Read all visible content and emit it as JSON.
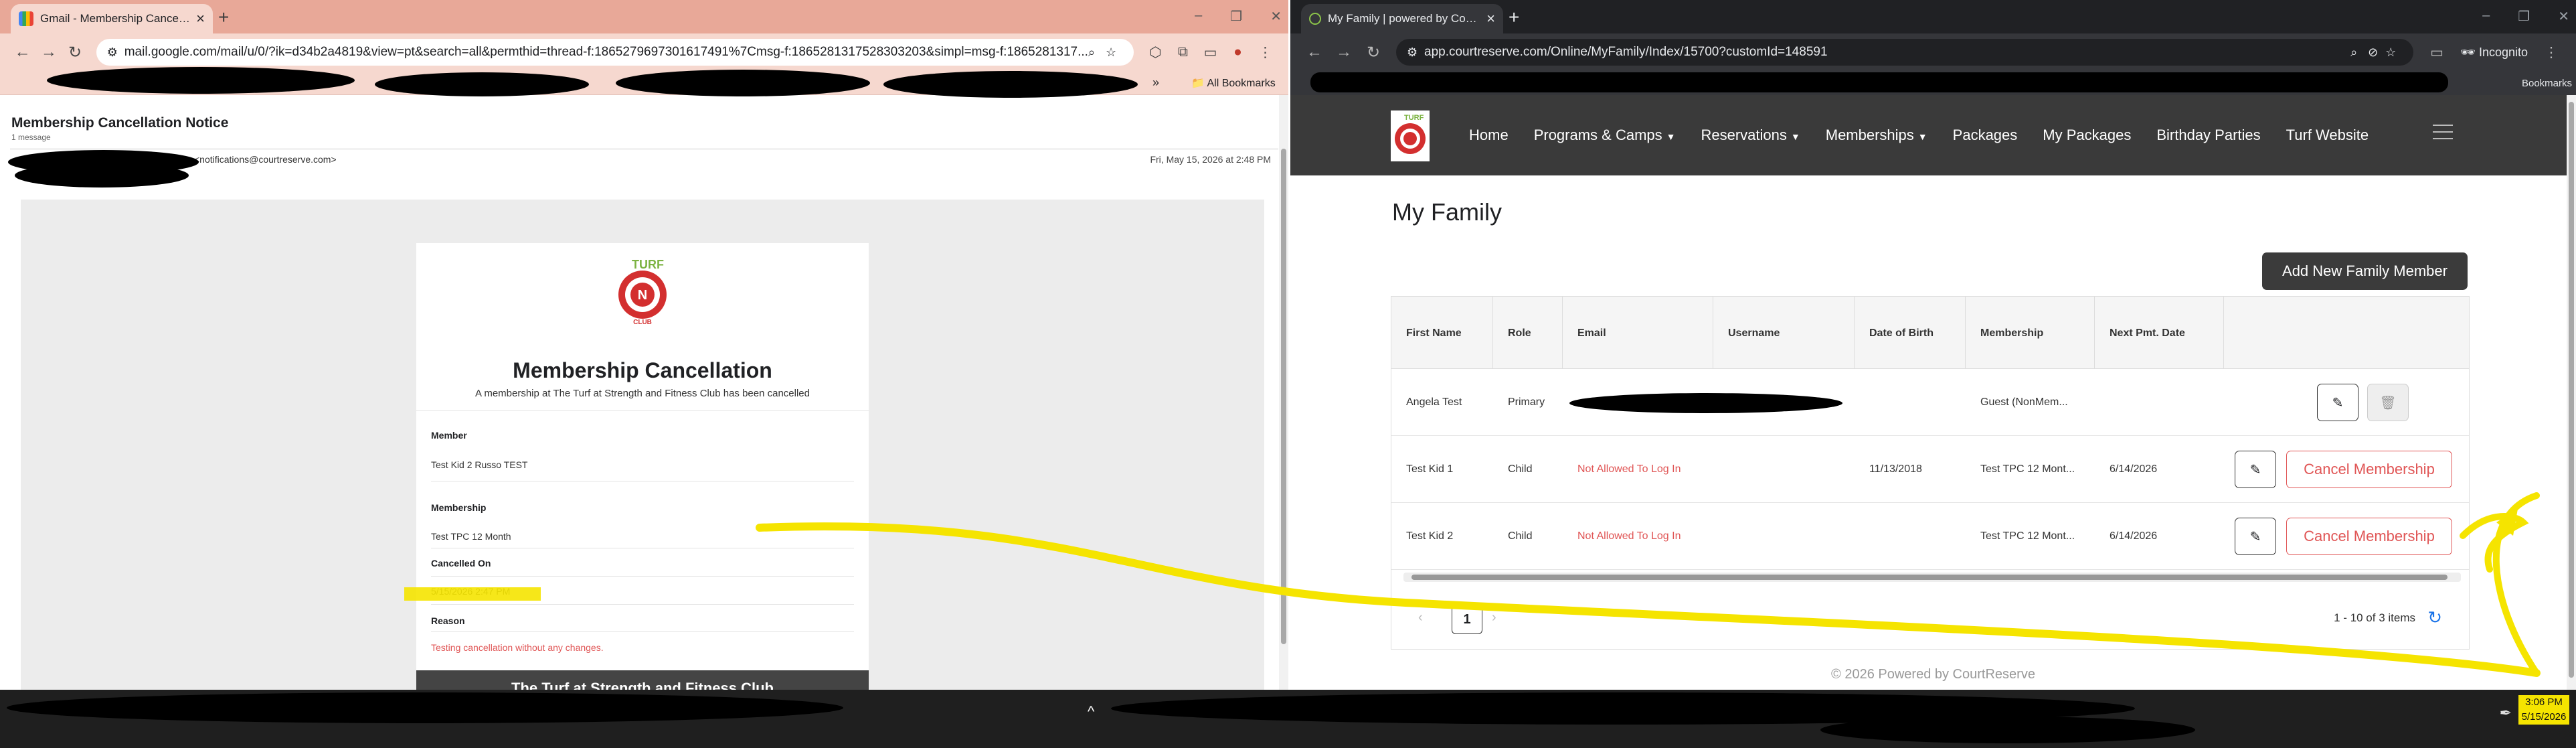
{
  "left_window": {
    "tab_title": "Gmail - Membership Cancellatio",
    "url": "mail.google.com/mail/u/0/?ik=d34b2a4819&view=pt&search=all&permthid=thread-f:1865279697301617491%7Cmsg-f:1865281317528303203&simpl=msg-f:1865281317...",
    "bookmarks_label": "All Bookmarks",
    "email": {
      "subject": "Membership Cancellation Notice",
      "message_count": "1 message",
      "from_address": "<notifications@courtreserve.com>",
      "date": "Fri, May 15, 2026 at 2:48 PM",
      "logo_text": "TURF",
      "logo_sub": "CLUB",
      "card_title": "Membership Cancellation",
      "card_subtitle": "A membership at The Turf at Strength and Fitness Club has been cancelled",
      "fields": [
        {
          "label": "Member",
          "value": "Test Kid 2 Russo TEST"
        },
        {
          "label": "Membership",
          "value": "Test TPC 12 Month"
        },
        {
          "label": "Cancelled On",
          "value": "5/15/2026 2:47 PM"
        },
        {
          "label": "Reason",
          "value": "Testing cancellation without any changes."
        }
      ],
      "footer_text": "The Turf at Strength and Fitness Club"
    }
  },
  "right_window": {
    "tab_title": "My Family | powered by CourtR",
    "url": "app.courtreserve.com/Online/MyFamily/Index/15700?customId=148591",
    "incognito_label": "Incognito",
    "bookmarks_label": "Bookmarks",
    "nav": [
      {
        "label": "Home",
        "dropdown": false
      },
      {
        "label": "Programs & Camps",
        "dropdown": true
      },
      {
        "label": "Reservations",
        "dropdown": true
      },
      {
        "label": "Memberships",
        "dropdown": true
      },
      {
        "label": "Packages",
        "dropdown": false
      },
      {
        "label": "My Packages",
        "dropdown": false
      },
      {
        "label": "Birthday Parties",
        "dropdown": false
      },
      {
        "label": "Turf Website",
        "dropdown": false
      }
    ],
    "page_title": "My Family",
    "add_button": "Add New Family Member",
    "columns": [
      "First Name",
      "Role",
      "Email",
      "Username",
      "Date of Birth",
      "Membership",
      "Next Pmt. Date"
    ],
    "rows": [
      {
        "first_name": "Angela Test",
        "role": "Primary",
        "email": "",
        "username": "",
        "dob": "",
        "membership": "Guest (NonMem...",
        "next_pmt": "",
        "cancel": ""
      },
      {
        "first_name": "Test Kid 1",
        "role": "Child",
        "email": "Not Allowed To Log In",
        "username": "",
        "dob": "11/13/2018",
        "membership": "Test TPC 12 Mont...",
        "next_pmt": "6/14/2026",
        "cancel": "Cancel Membership"
      },
      {
        "first_name": "Test Kid 2",
        "role": "Child",
        "email": "Not Allowed To Log In",
        "username": "",
        "dob": "",
        "membership": "Test TPC 12 Mont...",
        "next_pmt": "6/14/2026",
        "cancel": "Cancel Membership"
      }
    ],
    "pager": {
      "page": "1",
      "info": "1 - 10 of 3 items"
    },
    "footer": "© 2026 Powered by CourtReserve"
  },
  "taskbar": {
    "time": "3:06 PM",
    "date": "5/15/2026"
  },
  "colors": {
    "highlight": "#f5e400",
    "cancel_red": "#e05555",
    "nav_bg": "#3a3a3a"
  },
  "icons": [
    "gmail-icon",
    "courtreserve-icon",
    "edit-icon",
    "trash-icon",
    "refresh-icon",
    "pen-icon"
  ]
}
